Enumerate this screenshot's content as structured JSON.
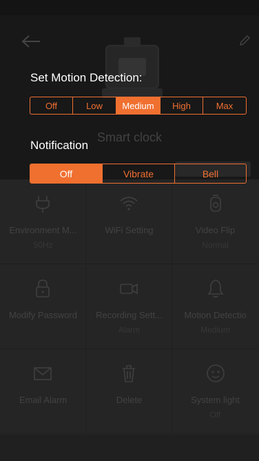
{
  "header": {
    "device_name": "Smart clock"
  },
  "motion": {
    "title": "Set Motion Detection:",
    "options": [
      "Off",
      "Low",
      "Medium",
      "High",
      "Max"
    ],
    "selected": "Medium"
  },
  "notification": {
    "title": "Notification",
    "options": [
      "Off",
      "Vibrate",
      "Bell"
    ],
    "selected": "Off"
  },
  "grid": {
    "tiles": [
      {
        "label": "Environment M...",
        "value": "50Hz",
        "icon": "plug-icon"
      },
      {
        "label": "WiFi Setting",
        "value": "",
        "icon": "wifi-icon"
      },
      {
        "label": "Video Flip",
        "value": "Normal",
        "icon": "flip-icon"
      },
      {
        "label": "Modify Password",
        "value": "",
        "icon": "lock-icon"
      },
      {
        "label": "Recording Sett...",
        "value": "Alarm",
        "icon": "video-camera-icon"
      },
      {
        "label": "Motion Detectio",
        "value": "Medium",
        "icon": "bell-icon"
      },
      {
        "label": "Email Alarm",
        "value": "",
        "icon": "envelope-icon"
      },
      {
        "label": "Delete",
        "value": "",
        "icon": "trash-icon"
      },
      {
        "label": "System light",
        "value": "Off",
        "icon": "light-icon"
      }
    ]
  },
  "colors": {
    "accent": "#f07030",
    "dialog_text": "#ffffff"
  }
}
